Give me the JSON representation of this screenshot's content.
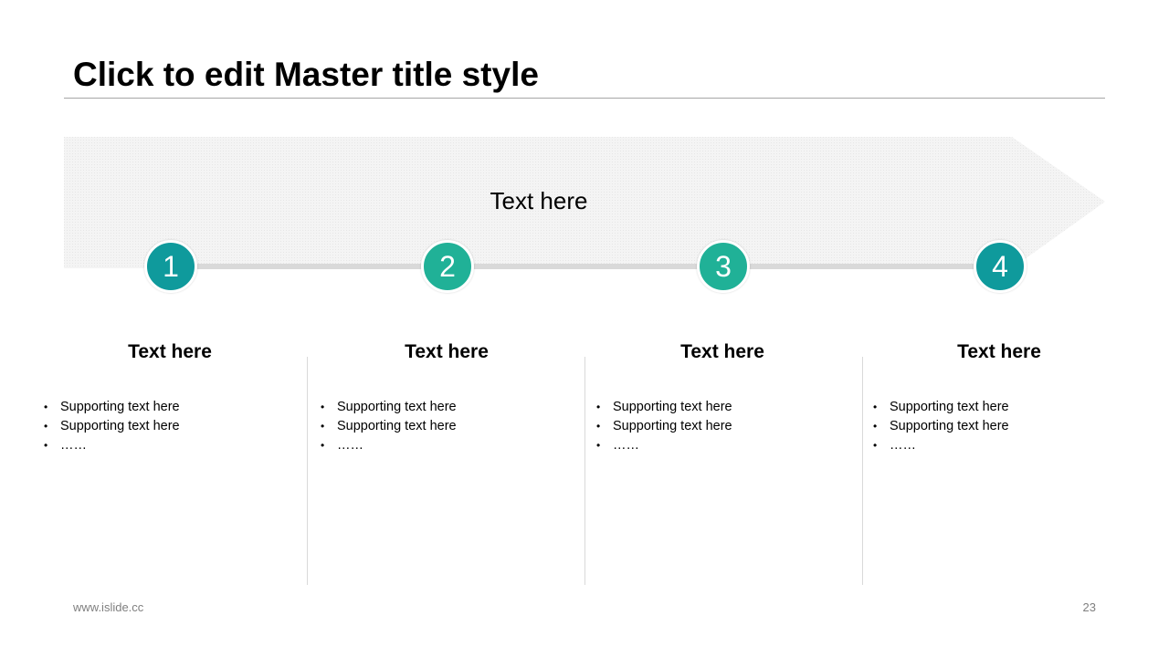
{
  "slide": {
    "title": "Click to edit Master title style",
    "banner_text": "Text here",
    "colors": {
      "banner": "#f2f2f2",
      "track": "#d9d9d9",
      "teal_dark": "#0f9a9c",
      "teal_green": "#20b197",
      "divider": "#d9d9d9",
      "rule": "#a6a6a6"
    },
    "steps": [
      {
        "number": "1",
        "color": "#0f9a9c"
      },
      {
        "number": "2",
        "color": "#20b197"
      },
      {
        "number": "3",
        "color": "#20b197"
      },
      {
        "number": "4",
        "color": "#0f9a9c"
      }
    ],
    "columns": [
      {
        "heading": "Text here",
        "bullets": [
          "Supporting  text here",
          "Supporting  text here",
          "……"
        ]
      },
      {
        "heading": "Text here",
        "bullets": [
          "Supporting  text here",
          "Supporting  text here",
          "……"
        ]
      },
      {
        "heading": "Text here",
        "bullets": [
          "Supporting  text here",
          "Supporting  text here",
          "……"
        ]
      },
      {
        "heading": "Text here",
        "bullets": [
          "Supporting  text here",
          "Supporting  text here",
          "……"
        ]
      }
    ]
  },
  "footer": {
    "url": "www.islide.cc",
    "page_number": "23"
  }
}
